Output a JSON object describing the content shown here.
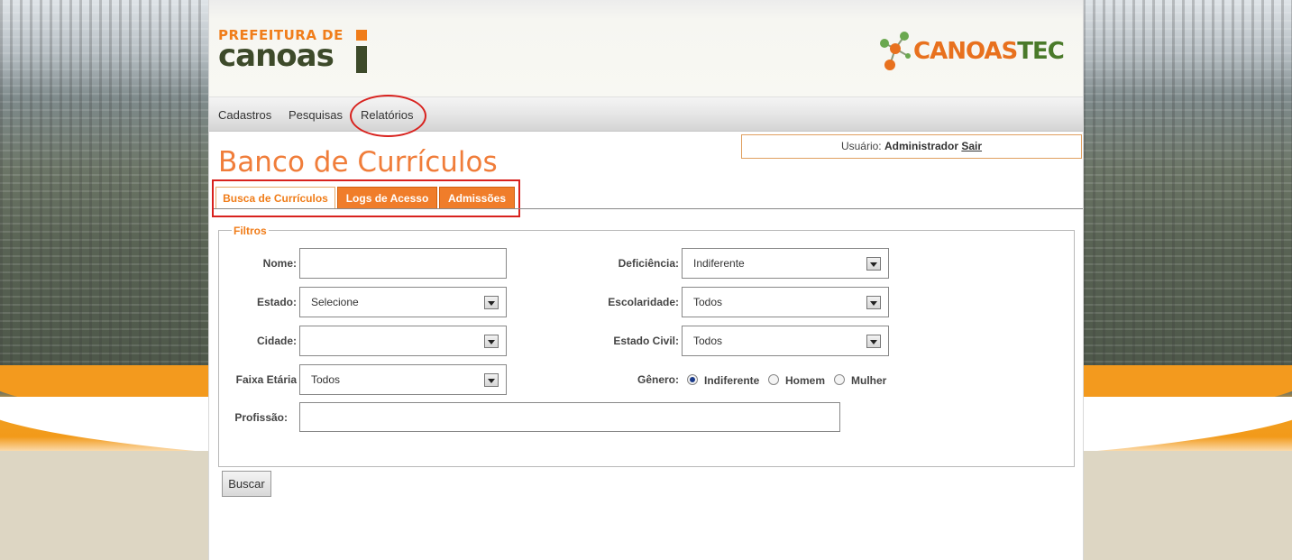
{
  "header": {
    "logo_left_line1": "PREFEITURA DE",
    "logo_left_line2": "canoas",
    "logo_right_a": "CANOAS",
    "logo_right_b": "TEC"
  },
  "menu": {
    "items": [
      "Cadastros",
      "Pesquisas",
      "Relatórios"
    ]
  },
  "user": {
    "label": "Usuário:",
    "name": "Administrador",
    "logout": "Sair"
  },
  "page_title": "Banco de Currículos",
  "tabs": [
    {
      "label": "Busca de Currículos",
      "active": true
    },
    {
      "label": "Logs de Acesso",
      "active": false
    },
    {
      "label": "Admissões",
      "active": false
    }
  ],
  "filters": {
    "legend": "Filtros",
    "nome": {
      "label": "Nome:",
      "value": ""
    },
    "estado": {
      "label": "Estado:",
      "value": "Selecione"
    },
    "cidade": {
      "label": "Cidade:",
      "value": ""
    },
    "faixa_etaria": {
      "label": "Faixa Etária",
      "value": "Todos"
    },
    "profissao": {
      "label": "Profissão:",
      "value": ""
    },
    "deficiencia": {
      "label": "Deficiência:",
      "value": "Indiferente"
    },
    "escolaridade": {
      "label": "Escolaridade:",
      "value": "Todos"
    },
    "estado_civil": {
      "label": "Estado Civil:",
      "value": "Todos"
    },
    "genero": {
      "label": "Gênero:",
      "options": [
        "Indiferente",
        "Homem",
        "Mulher"
      ],
      "selected": "Indiferente"
    }
  },
  "search_button": "Buscar",
  "colors": {
    "accent": "#f07d1a",
    "annotation": "#d8221e"
  }
}
